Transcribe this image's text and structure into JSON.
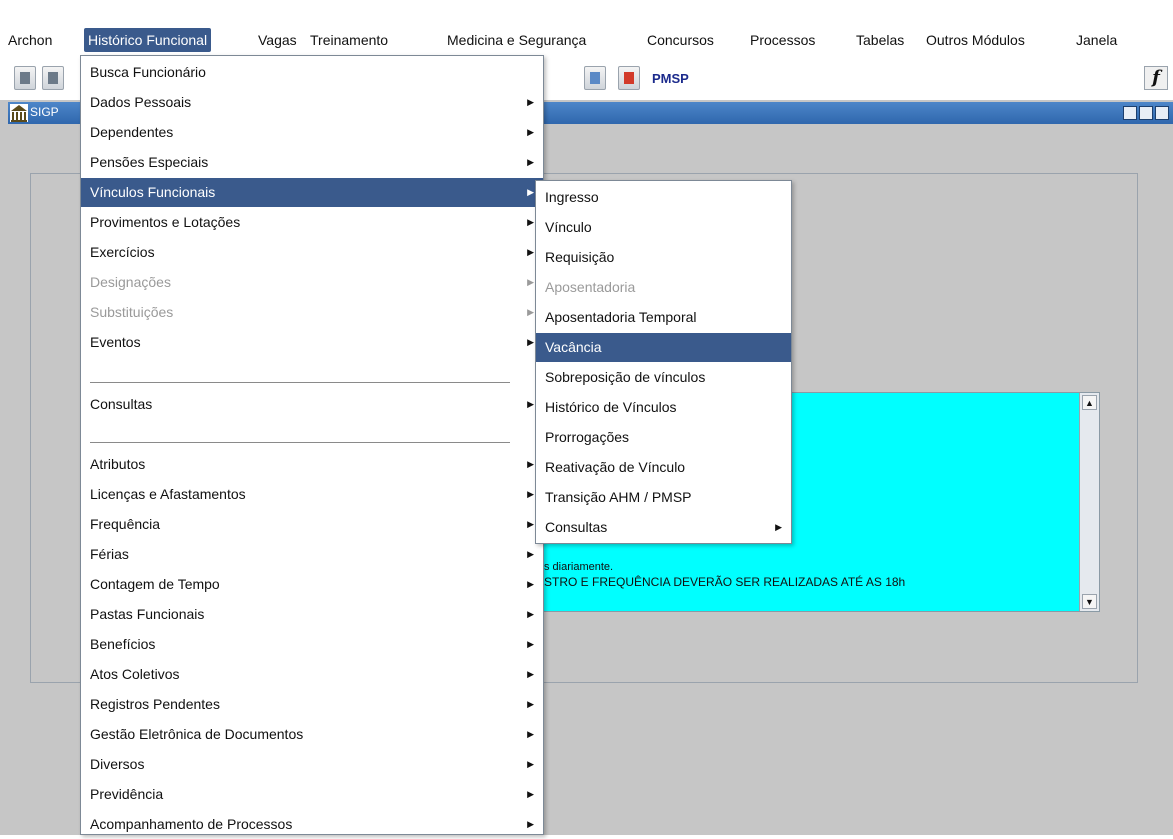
{
  "menubar": {
    "items": [
      {
        "label": "Archon"
      },
      {
        "label": "Histórico Funcional"
      },
      {
        "label": "Vagas"
      },
      {
        "label": "Treinamento"
      },
      {
        "label": "Medicina e Segurança"
      },
      {
        "label": "Concursos"
      },
      {
        "label": "Processos"
      },
      {
        "label": "Tabelas"
      },
      {
        "label": "Outros Módulos"
      },
      {
        "label": "Janela"
      }
    ]
  },
  "toolbar": {
    "org_label": "PMSP",
    "function_label": "f"
  },
  "window": {
    "title": "SIGP"
  },
  "notice": {
    "line1": "s diariamente.",
    "line2": "STRO E FREQUÊNCIA DEVERÃO SER REALIZADAS ATÉ AS 18h"
  },
  "main_menu": {
    "items": [
      {
        "label": "Busca Funcionário",
        "submenu": false,
        "enabled": true
      },
      {
        "label": "Dados Pessoais",
        "submenu": true,
        "enabled": true
      },
      {
        "label": "Dependentes",
        "submenu": true,
        "enabled": true
      },
      {
        "label": "Pensões Especiais",
        "submenu": true,
        "enabled": true
      },
      {
        "label": "Vínculos Funcionais",
        "submenu": true,
        "enabled": true,
        "active": true
      },
      {
        "label": "Provimentos e Lotações",
        "submenu": true,
        "enabled": true
      },
      {
        "label": "Exercícios",
        "submenu": true,
        "enabled": true
      },
      {
        "label": "Designações",
        "submenu": true,
        "enabled": false
      },
      {
        "label": "Substituições",
        "submenu": true,
        "enabled": false
      },
      {
        "label": "Eventos",
        "submenu": true,
        "enabled": true
      },
      {
        "label": "Consultas",
        "submenu": true,
        "enabled": true
      },
      {
        "label": "Atributos",
        "submenu": true,
        "enabled": true
      },
      {
        "label": "Licenças e Afastamentos",
        "submenu": true,
        "enabled": true
      },
      {
        "label": "Frequência",
        "submenu": true,
        "enabled": true
      },
      {
        "label": "Férias",
        "submenu": true,
        "enabled": true
      },
      {
        "label": "Contagem de Tempo",
        "submenu": true,
        "enabled": true
      },
      {
        "label": "Pastas Funcionais",
        "submenu": true,
        "enabled": true
      },
      {
        "label": "Benefícios",
        "submenu": true,
        "enabled": true
      },
      {
        "label": "Atos Coletivos",
        "submenu": true,
        "enabled": true
      },
      {
        "label": "Registros Pendentes",
        "submenu": true,
        "enabled": true
      },
      {
        "label": "Gestão Eletrônica de Documentos",
        "submenu": true,
        "enabled": true
      },
      {
        "label": "Diversos",
        "submenu": true,
        "enabled": true
      },
      {
        "label": "Previdência",
        "submenu": true,
        "enabled": true
      },
      {
        "label": "Acompanhamento de Processos",
        "submenu": true,
        "enabled": true
      }
    ]
  },
  "sub_menu": {
    "items": [
      {
        "label": "Ingresso",
        "submenu": false,
        "enabled": true
      },
      {
        "label": "Vínculo",
        "submenu": false,
        "enabled": true
      },
      {
        "label": "Requisição",
        "submenu": false,
        "enabled": true
      },
      {
        "label": "Aposentadoria",
        "submenu": false,
        "enabled": false
      },
      {
        "label": "Aposentadoria Temporal",
        "submenu": false,
        "enabled": true
      },
      {
        "label": "Vacância",
        "submenu": false,
        "enabled": true,
        "active": true
      },
      {
        "label": "Sobreposição de vínculos",
        "submenu": false,
        "enabled": true
      },
      {
        "label": "Histórico de Vínculos",
        "submenu": false,
        "enabled": true
      },
      {
        "label": "Prorrogações",
        "submenu": false,
        "enabled": true
      },
      {
        "label": "Reativação de Vínculo",
        "submenu": false,
        "enabled": true
      },
      {
        "label": "Transição AHM / PMSP",
        "submenu": false,
        "enabled": true
      },
      {
        "label": "Consultas",
        "submenu": true,
        "enabled": true
      }
    ]
  },
  "colors": {
    "menu_highlight": "#3a5a8c",
    "workspace_bg": "#c6c6c6",
    "notice_bg": "#00ffff",
    "disabled_text": "#9a9a9a"
  }
}
